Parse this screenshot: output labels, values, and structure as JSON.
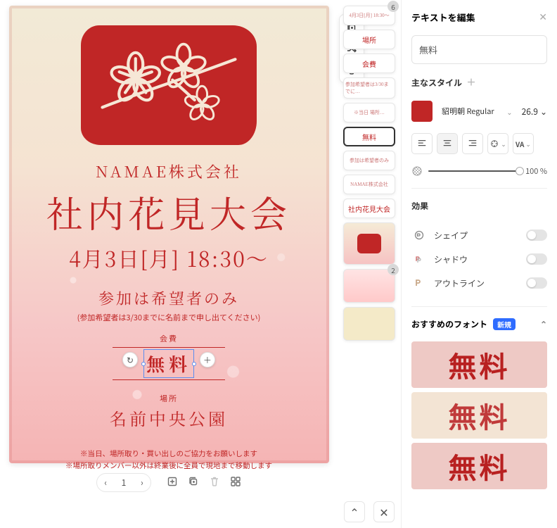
{
  "panel": {
    "title": "テキストを編集",
    "text_value": "無料",
    "main_style_label": "主なスタイル",
    "swatch_color": "#c02626",
    "font_name": "貂明朝 Regular",
    "font_size": "26.9",
    "opacity_label": "100 %",
    "opacity_pct": 100,
    "effects_label": "効果",
    "effects": [
      {
        "name": "シェイプ"
      },
      {
        "name": "シャドウ"
      },
      {
        "name": "アウトライン"
      }
    ],
    "rec_label": "おすすめのフォント",
    "rec_badge": "新規",
    "rec_items": [
      "無料",
      "無料",
      "無料"
    ]
  },
  "canvas": {
    "company": "NAMAE株式会社",
    "title": "社内花見大会",
    "datetime": "4月3日[月] 18:30〜",
    "sub": "参加は希望者のみ",
    "note_small": "(参加希望者は3/30までに名前まで申し出てください)",
    "fee_label": "会費",
    "fee": "無料",
    "place_label": "場所",
    "place": "名前中央公園",
    "foot1": "※当日、場所取り・買い出しのご協力をお願いします",
    "foot2": "※場所取りメンバー以外は終業後に全員で現地まで移動します"
  },
  "layers": {
    "group_count": "6",
    "items": [
      {
        "text": "4月3日[月] 18:30〜",
        "cls": "small-txt"
      },
      {
        "text": "場所"
      },
      {
        "text": "会費"
      },
      {
        "text": "参加希望者は3/30までに…",
        "cls": "small-txt"
      },
      {
        "text": "※当日 場所…",
        "cls": "small-txt"
      },
      {
        "text": "無料",
        "selected": true
      },
      {
        "text": "参加は希望者のみ",
        "cls": "small-txt"
      },
      {
        "text": "NAMAE株式会社",
        "cls": "small-txt"
      },
      {
        "text": "社内花見大会"
      }
    ],
    "extra_badge": "2"
  },
  "page": {
    "current": "1"
  }
}
